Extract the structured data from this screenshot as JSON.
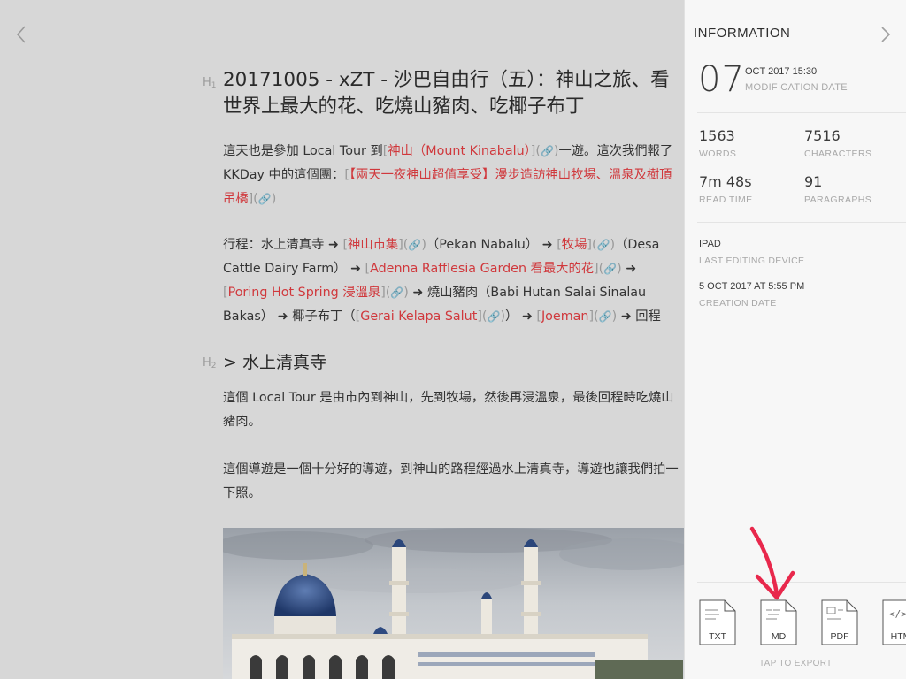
{
  "editor": {
    "h1_marker": "H",
    "h1_marker_sub": "1",
    "h2_marker": "H",
    "h2_marker_sub": "2",
    "title": "20171005 - xZT - 沙巴自由行（五）：神山之旅、看世界上最大的花、吃燒山豬肉、吃椰子布丁",
    "para1": {
      "pre": "這天也是參加 Local Tour 到",
      "link1": "神山（Mount Kinabalu）",
      "post": "一遊。這次我們報了 KKDay 中的這個團：",
      "link2": "【兩天一夜神山超值享受】漫步造訪神山牧場、溫泉及樹頂吊橋"
    },
    "para2": {
      "pre": "行程：水上清真寺 ➜ ",
      "link1": "神山市集",
      "mid1": "（Pekan Nabalu） ➜ ",
      "link2": "牧場",
      "mid2": "（Desa Cattle Dairy Farm） ➜ ",
      "link3": "Adenna Rafflesia Garden 看最大的花",
      "mid3": " ➜ ",
      "link4": "Poring Hot Spring 浸溫泉",
      "mid4": " ➜ 燒山豬肉（Babi Hutan Salai Sinalau Bakas） ➜ 椰子布丁（",
      "link5": "Gerai Kelapa Salut",
      "mid5": "） ➜ ",
      "link6": "Joeman",
      "post": " ➜ 回程"
    },
    "h2": "> 水上清真寺",
    "para3": "這個 Local Tour 是由市內到神山，先到牧場，然後再浸溫泉，最後回程時吃燒山豬肉。",
    "para4": "這個導遊是一個十分好的導遊，到神山的路程經過水上清真寺，導遊也讓我們拍一下照。",
    "md_open": "[",
    "md_mid": "](",
    "md_close": ")",
    "chain_icon": "🔗"
  },
  "info": {
    "title": "INFORMATION",
    "mod_day": "07",
    "mod_datetime": "OCT 2017 15:30",
    "mod_label": "MODIFICATION DATE",
    "stats": {
      "words_val": "1563",
      "words_lbl": "WORDS",
      "chars_val": "7516",
      "chars_lbl": "CHARACTERS",
      "read_val": "7m 48s",
      "read_lbl": "READ TIME",
      "paras_val": "91",
      "paras_lbl": "PARAGRAPHS"
    },
    "device_val": "IPAD",
    "device_lbl": "LAST EDITING DEVICE",
    "created_val": "5 OCT 2017 AT 5:55 PM",
    "created_lbl": "CREATION DATE",
    "exports": [
      {
        "label": "TXT"
      },
      {
        "label": "MD"
      },
      {
        "label": "PDF"
      },
      {
        "label": "HTM"
      }
    ],
    "tap_export": "TAP TO EXPORT"
  },
  "colors": {
    "link": "#d0383c",
    "annotation": "#e8284c",
    "panel_bg": "#f7f7f7",
    "editor_bg": "#d7d7d7"
  }
}
